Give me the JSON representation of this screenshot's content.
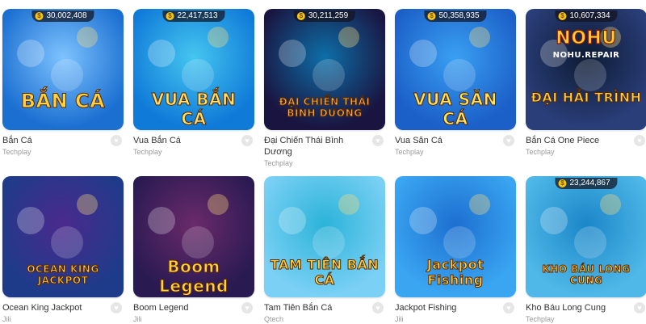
{
  "games": [
    {
      "name": "Bắn Cá",
      "provider": "Techplay",
      "jackpot": "30,002,408",
      "logo": "BẮN CÁ",
      "logo_color": "#ffd23f",
      "bg": [
        "#1b6fd1",
        "#7ec3ff"
      ]
    },
    {
      "name": "Vua Bắn Cá",
      "provider": "Techplay",
      "jackpot": "22,417,513",
      "logo": "VUA BẮN CÁ",
      "logo_color": "#ffe066",
      "bg": [
        "#0f7ad8",
        "#45c6f0"
      ]
    },
    {
      "name": "Đại Chiến Thái Bình Dương",
      "provider": "Techplay",
      "jackpot": "30,211,259",
      "logo": "ĐẠI CHIẾN THÁI BÌNH DƯƠNG",
      "logo_color": "#ffb347",
      "bg": [
        "#1a1440",
        "#0d6fa8"
      ]
    },
    {
      "name": "Vua Săn Cá",
      "provider": "Techplay",
      "jackpot": "50,358,935",
      "logo": "VUA SĂN CÁ",
      "logo_color": "#ffe45c",
      "bg": [
        "#1b5fc8",
        "#3aa0f2"
      ]
    },
    {
      "name": "Bắn Cá One Piece",
      "provider": "Techplay",
      "jackpot": "10,607,334",
      "logo": "ĐẠI HẢI TRÌNH",
      "logo_color": "#ffd23f",
      "bg": [
        "#2a3e7a",
        "#0d1b33"
      ],
      "brand_top": "NOHU",
      "brand_sub": "NOHU.REPAIR"
    },
    {
      "name": "Ocean King Jackpot",
      "provider": "Jili",
      "jackpot": "",
      "logo": "OCEAN KING JACKPOT",
      "logo_color": "#ffd23f",
      "bg": [
        "#1e3b8a",
        "#4b2a8c"
      ]
    },
    {
      "name": "Boom Legend",
      "provider": "Jili",
      "jackpot": "",
      "logo": "Boom Legend",
      "logo_color": "#ffd23f",
      "bg": [
        "#2a1a52",
        "#6a2a6a"
      ]
    },
    {
      "name": "Tam Tiên Bắn Cá",
      "provider": "Qtech",
      "jackpot": "",
      "logo": "TAM TIÊN BẮN CÁ",
      "logo_color": "#ffd23f",
      "bg": [
        "#7bd0f5",
        "#2bb3d8"
      ]
    },
    {
      "name": "Jackpot Fishing",
      "provider": "Jili",
      "jackpot": "",
      "logo": "Jackpot Fishing",
      "logo_color": "#ffd23f",
      "bg": [
        "#3aa6f2",
        "#1d6fd0"
      ]
    },
    {
      "name": "Kho Báu Long Cung",
      "provider": "Techplay",
      "jackpot": "23,244,867",
      "logo": "KHO BÁU LONG CUNG",
      "logo_color": "#ffd23f",
      "bg": [
        "#4fb8e8",
        "#1b86c8"
      ]
    }
  ],
  "icons": {
    "coin": "coin-icon",
    "favorite": "heart-icon"
  },
  "coin_symbol": "$",
  "heart_symbol": "♥"
}
